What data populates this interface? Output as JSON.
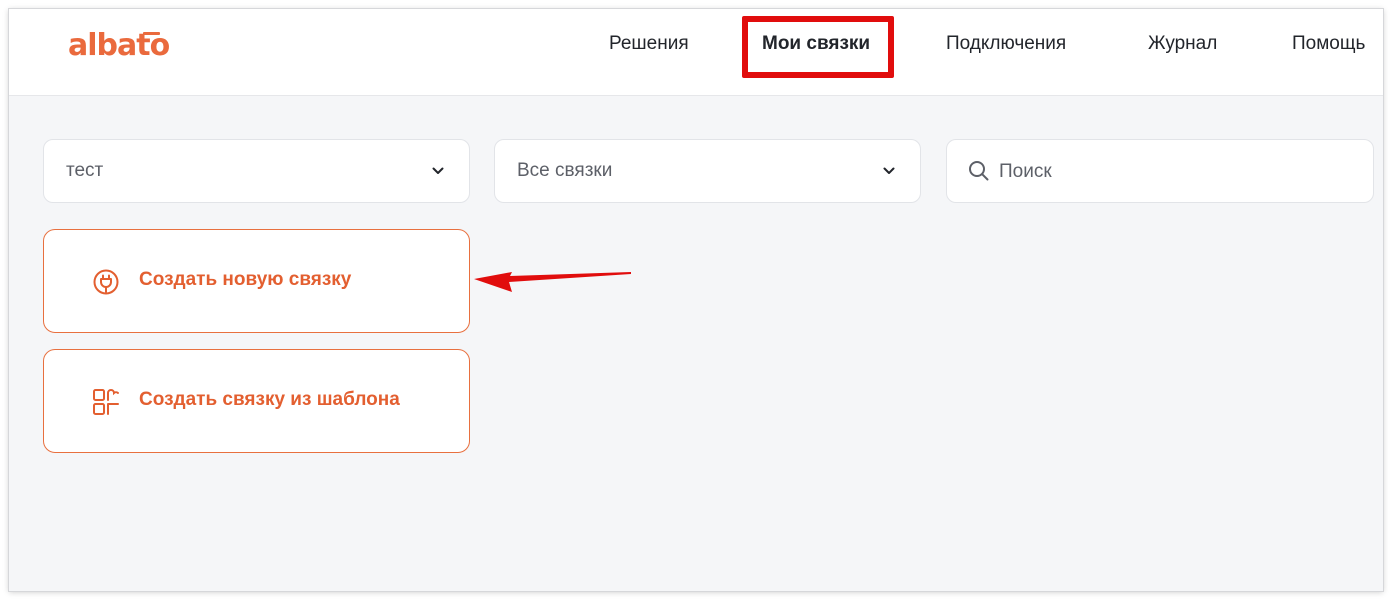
{
  "brand": {
    "logo_text": "albato",
    "color": "#ea6a3d"
  },
  "nav": {
    "items": [
      {
        "label": "Решения"
      },
      {
        "label": "Мои связки",
        "active": true
      },
      {
        "label": "Подключения"
      },
      {
        "label": "Журнал"
      },
      {
        "label": "Помощь"
      }
    ],
    "highlight_color": "#e10d0d"
  },
  "filters": {
    "folder": {
      "value": "тест",
      "icon": "chevron-down-icon"
    },
    "bundle_type": {
      "value": "Все связки",
      "icon": "chevron-down-icon"
    },
    "search": {
      "placeholder": "Поиск",
      "icon": "search-icon"
    }
  },
  "actions": [
    {
      "label": "Создать новую связку",
      "icon": "plug-icon"
    },
    {
      "label": "Создать связку из шаблона",
      "icon": "template-icon"
    }
  ],
  "annotation": {
    "icon": "red-arrow-icon",
    "color": "#e10d0d"
  }
}
